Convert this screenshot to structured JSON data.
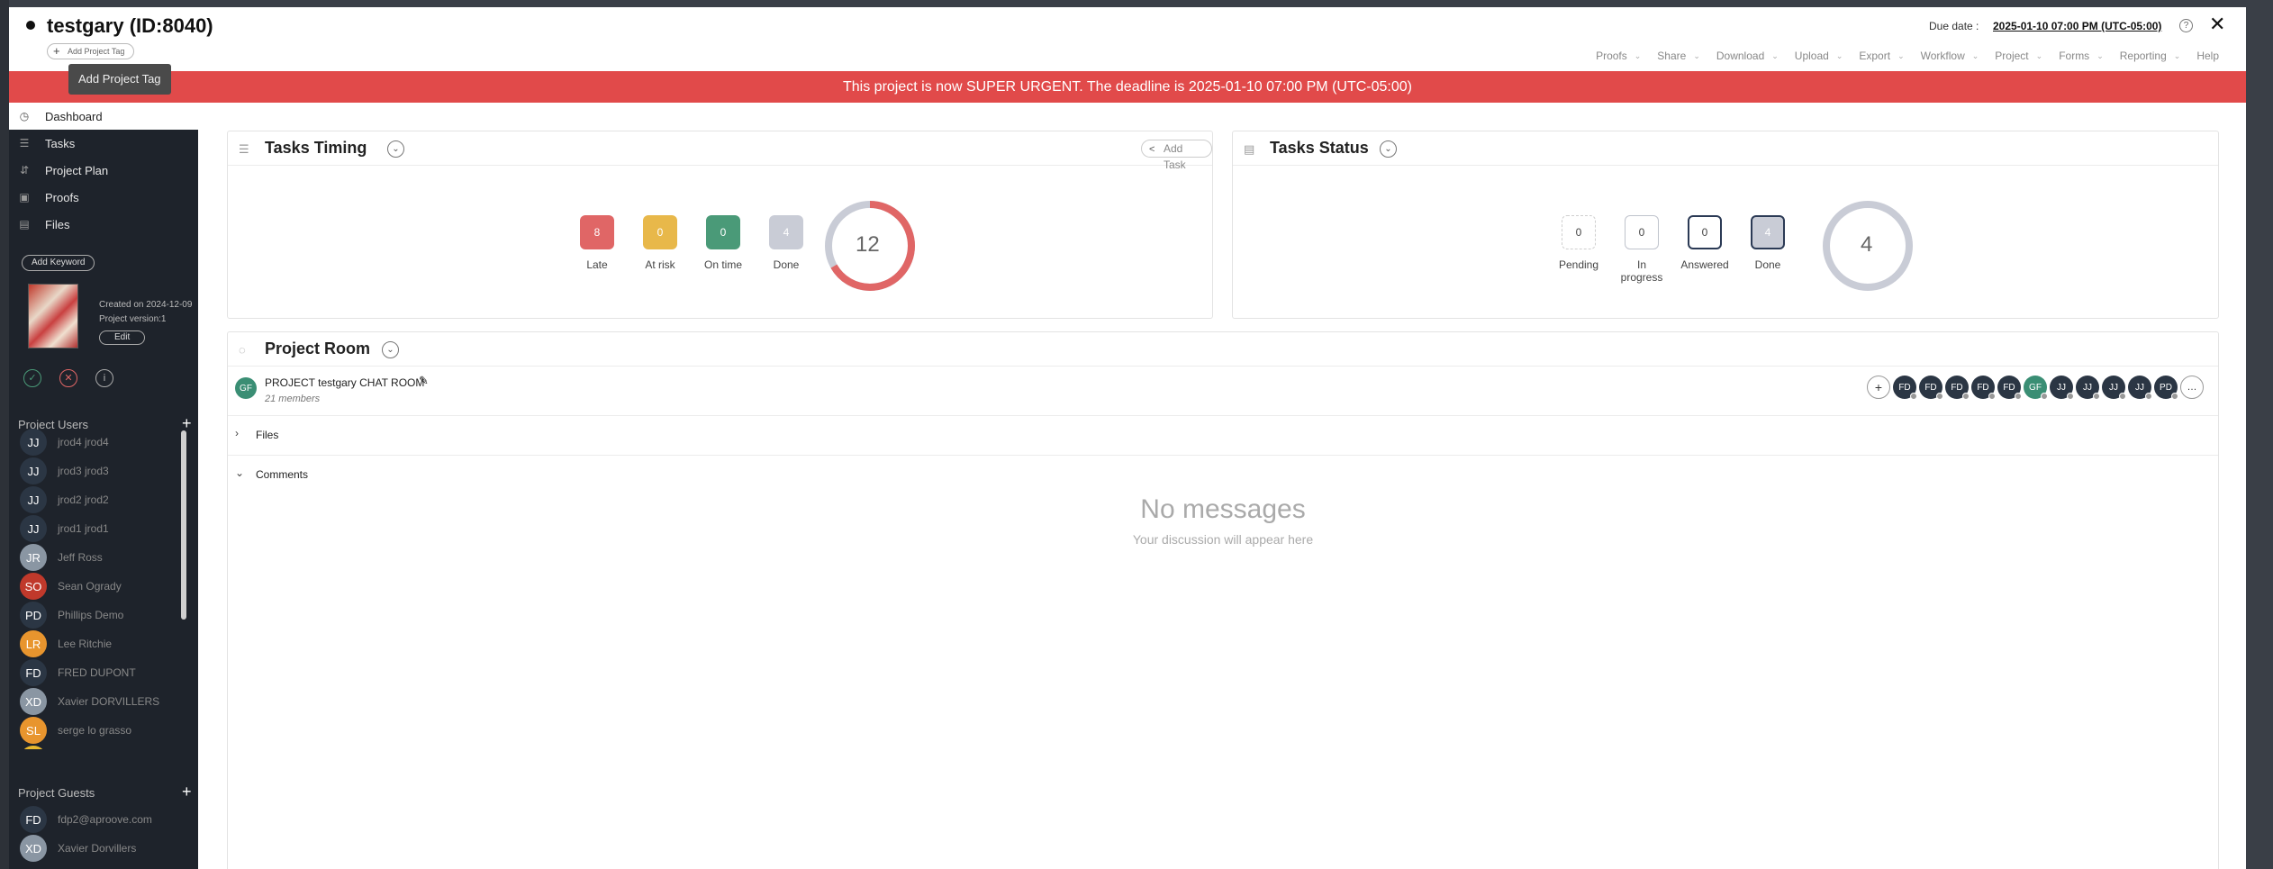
{
  "header": {
    "title": "testgary (ID:8040)",
    "add_tag_label": "Add Project Tag",
    "tooltip": "Add Project Tag",
    "due_label": "Due date :",
    "due_value": "2025-01-10 07:00 PM (UTC-05:00)",
    "help_glyph": "?",
    "close_glyph": "✕",
    "menu": [
      {
        "label": "Proofs"
      },
      {
        "label": "Share"
      },
      {
        "label": "Download"
      },
      {
        "label": "Upload"
      },
      {
        "label": "Export"
      },
      {
        "label": "Workflow"
      },
      {
        "label": "Project"
      },
      {
        "label": "Forms"
      },
      {
        "label": "Reporting"
      },
      {
        "label": "Help"
      }
    ]
  },
  "banner": {
    "text": "This project is now SUPER URGENT. The deadline is 2025-01-10 07:00 PM (UTC-05:00)",
    "color": "#e14a4a"
  },
  "sidebar": {
    "nav": [
      {
        "label": "Dashboard",
        "icon": "dashboard-icon"
      },
      {
        "label": "Tasks",
        "icon": "tasks-icon"
      },
      {
        "label": "Project Plan",
        "icon": "project-plan-icon"
      },
      {
        "label": "Proofs",
        "icon": "proofs-icon"
      },
      {
        "label": "Files",
        "icon": "files-icon"
      }
    ],
    "add_keyword": "Add Keyword",
    "created": "Created on 2024-12-09",
    "version": "Project version:1",
    "edit": "Edit",
    "users_title": "Project Users",
    "users": [
      {
        "initials": "JJ",
        "name": "jrod4  jrod4",
        "color": "#2b3644"
      },
      {
        "initials": "JJ",
        "name": "jrod3  jrod3",
        "color": "#2b3644"
      },
      {
        "initials": "JJ",
        "name": "jrod2  jrod2",
        "color": "#2b3644"
      },
      {
        "initials": "JJ",
        "name": "jrod1  jrod1",
        "color": "#2b3644"
      },
      {
        "initials": "JR",
        "name": "Jeff  Ross",
        "color": "#8a96a3"
      },
      {
        "initials": "SO",
        "name": "Sean  Ogrady",
        "color": "#c0392b"
      },
      {
        "initials": "PD",
        "name": "Phillips  Demo",
        "color": "#2b3644"
      },
      {
        "initials": "LR",
        "name": "Lee  Ritchie",
        "color": "#e8952e"
      },
      {
        "initials": "FD",
        "name": "FRED  DUPONT",
        "color": "#2b3644"
      },
      {
        "initials": "XD",
        "name": "Xavier  DORVILLERS",
        "color": "#8a96a3"
      },
      {
        "initials": "SL",
        "name": "serge  lo grasso",
        "color": "#e8952e"
      },
      {
        "initials": "",
        "name": "",
        "color": "#e8b82e"
      }
    ],
    "guests_title": "Project Guests",
    "guests": [
      {
        "initials": "FD",
        "name": "fdp2@aproove.com",
        "color": "#2b3644"
      },
      {
        "initials": "XD",
        "name": "Xavier  Dorvillers",
        "color": "#8a96a3"
      }
    ]
  },
  "tasks_timing": {
    "title": "Tasks Timing",
    "add_task": "Add Task",
    "stats": [
      {
        "value": "8",
        "label": "Late",
        "color": "#e06666"
      },
      {
        "value": "0",
        "label": "At risk",
        "color": "#e8b84a"
      },
      {
        "value": "0",
        "label": "On time",
        "color": "#4a9a78"
      },
      {
        "value": "4",
        "label": "Done",
        "color": "#c9ccd6"
      }
    ],
    "total": "12",
    "late_fraction": 0.667
  },
  "tasks_status": {
    "title": "Tasks Status",
    "stats": [
      {
        "value": "0",
        "label": "Pending"
      },
      {
        "value": "0",
        "label": "In progress"
      },
      {
        "value": "0",
        "label": "Answered"
      },
      {
        "value": "4",
        "label": "Done"
      }
    ],
    "total": "4"
  },
  "project_room": {
    "title": "Project Room",
    "avatar": "GF",
    "name": "PROJECT testgary CHAT ROOM",
    "members": "21 members",
    "strip": [
      {
        "initials": "FD",
        "color": "#2b3644"
      },
      {
        "initials": "FD",
        "color": "#2b3644"
      },
      {
        "initials": "FD",
        "color": "#2b3644"
      },
      {
        "initials": "FD",
        "color": "#2b3644"
      },
      {
        "initials": "FD",
        "color": "#2b3644"
      },
      {
        "initials": "GF",
        "color": "#3a8e74"
      },
      {
        "initials": "JJ",
        "color": "#2b3644"
      },
      {
        "initials": "JJ",
        "color": "#2b3644"
      },
      {
        "initials": "JJ",
        "color": "#2b3644"
      },
      {
        "initials": "JJ",
        "color": "#2b3644"
      },
      {
        "initials": "PD",
        "color": "#2b3644"
      }
    ],
    "files_label": "Files",
    "comments_label": "Comments",
    "no_messages": "No messages",
    "no_messages_sub": "Your discussion will appear here"
  }
}
